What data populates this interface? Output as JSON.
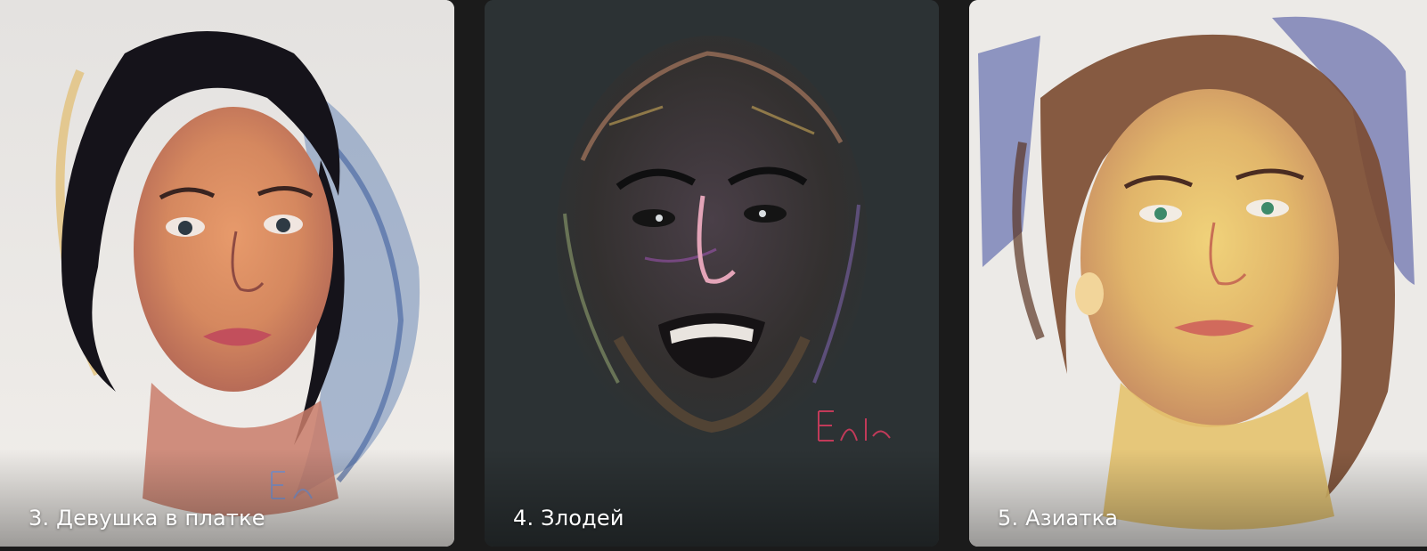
{
  "gallery": {
    "items": [
      {
        "caption": "3. Девушка в платке",
        "image": "pastel-portrait-girl-headscarf",
        "paper_color": "#ece9e5"
      },
      {
        "caption": "4. Злодей",
        "image": "pastel-portrait-villain",
        "paper_color": "#2c3234"
      },
      {
        "caption": "5. Азиатка",
        "image": "pastel-portrait-asian-woman",
        "paper_color": "#eceae7"
      }
    ]
  }
}
